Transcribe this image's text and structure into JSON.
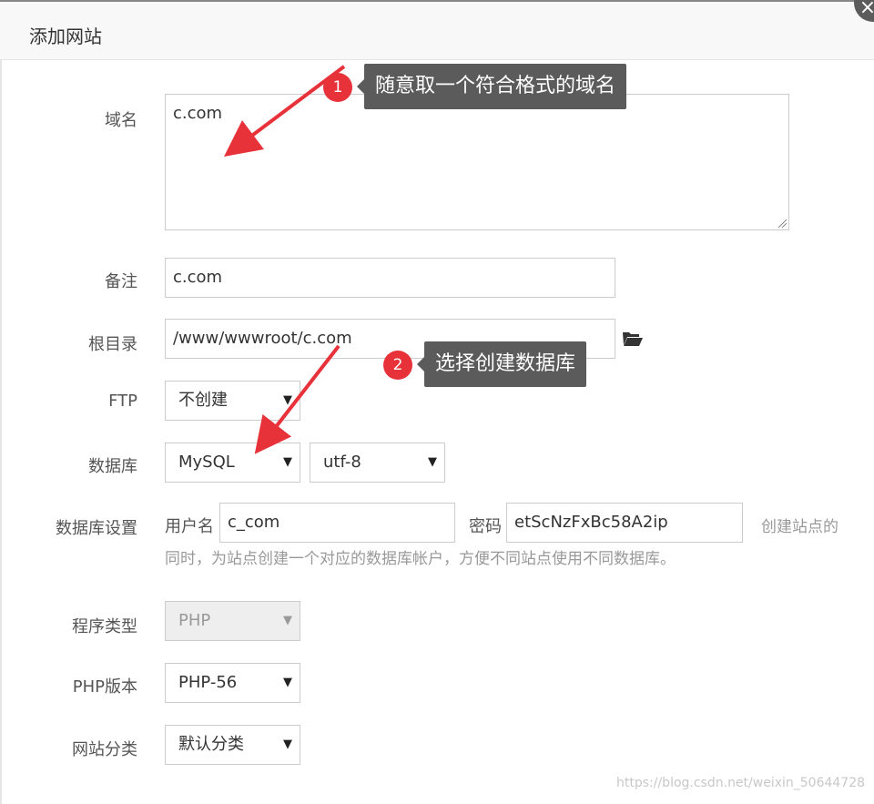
{
  "dialog": {
    "title": "添加网站",
    "close_glyph": "×"
  },
  "form": {
    "domain": {
      "label": "域名",
      "value": "c.com"
    },
    "remark": {
      "label": "备注",
      "value": "c.com"
    },
    "root_dir": {
      "label": "根目录",
      "value": "/www/wwwroot/c.com",
      "browse_icon": "folder-open-icon"
    },
    "ftp": {
      "label": "FTP",
      "selected": "不创建"
    },
    "database": {
      "label": "数据库",
      "type_selected": "MySQL",
      "charset_selected": "utf-8"
    },
    "db_settings": {
      "label": "数据库设置",
      "username_label": "用户名",
      "username_value": "c_com",
      "password_label": "密码",
      "password_value": "etScNzFxBc58A2ip",
      "hint_line1": "创建站点的",
      "hint_line2": "同时，为站点创建一个对应的数据库帐户，方便不同站点使用不同数据库。"
    },
    "program_type": {
      "label": "程序类型",
      "selected": "PHP"
    },
    "php_version": {
      "label": "PHP版本",
      "selected": "PHP-56"
    },
    "site_category": {
      "label": "网站分类",
      "selected": "默认分类"
    },
    "dropdown_glyph": "▼"
  },
  "annotations": [
    {
      "number": "1",
      "text": "随意取一个符合格式的域名"
    },
    {
      "number": "2",
      "text": "选择创建数据库"
    }
  ],
  "colors": {
    "annotation_red": "#e8323a",
    "callout_bg": "#5b5b5b"
  },
  "watermark": "https://blog.csdn.net/weixin_50644728"
}
